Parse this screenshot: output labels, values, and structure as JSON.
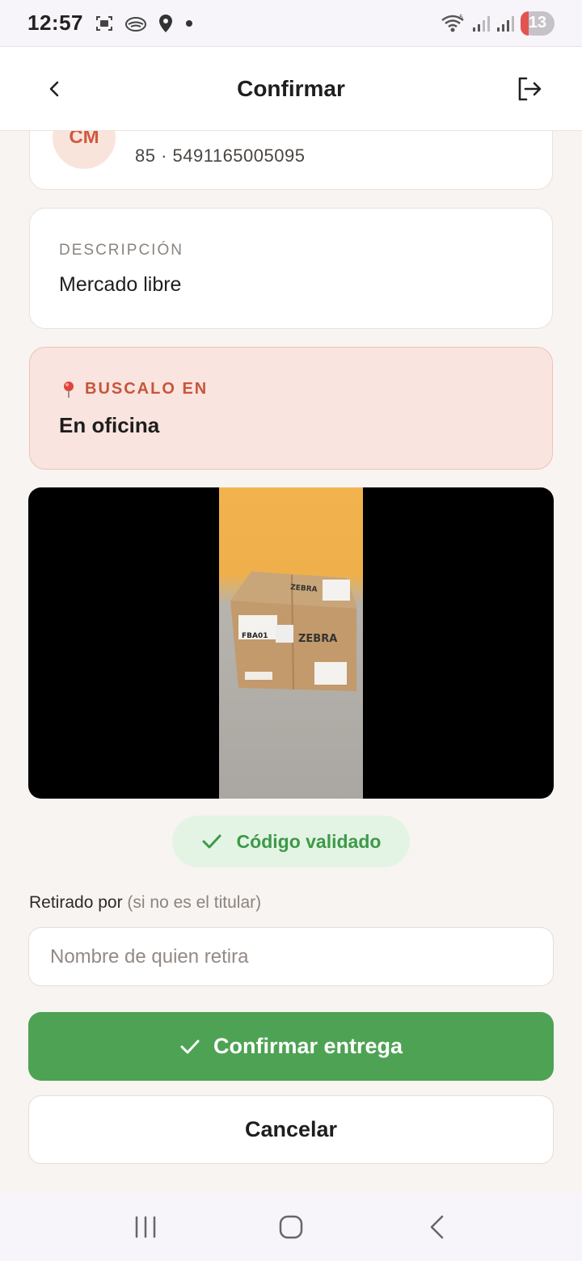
{
  "status_bar": {
    "time": "12:57",
    "battery_level": "13",
    "icons": [
      "screenshot-icon",
      "cloud-icon",
      "location-icon",
      "dot-icon",
      "wifi-icon",
      "signal-icon",
      "signal-icon",
      "battery-icon"
    ]
  },
  "header": {
    "title": "Confirmar",
    "back_icon": "chevron-left-icon",
    "logout_icon": "logout-icon"
  },
  "customer": {
    "initials": "CM",
    "phone_line": "85 · 5491165005095"
  },
  "description": {
    "label": "DESCRIPCIÓN",
    "value": "Mercado libre"
  },
  "location": {
    "label": "BUSCALO EN",
    "value": "En oficina",
    "icon": "pin-icon"
  },
  "photo": {
    "box_label": "FBA01",
    "brand": "ZEBRA"
  },
  "validation": {
    "text": "Código validado",
    "icon": "check-icon"
  },
  "form": {
    "label": "Retirado por",
    "hint": "(si no es el titular)",
    "placeholder": "Nombre de quien retira",
    "value": ""
  },
  "actions": {
    "confirm_label": "Confirmar entrega",
    "cancel_label": "Cancelar"
  },
  "colors": {
    "accent_green": "#4ea254",
    "accent_orange": "#c9553a",
    "location_bg": "#f9e4df"
  }
}
